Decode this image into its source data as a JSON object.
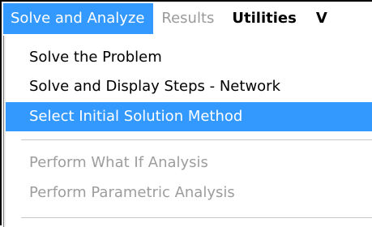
{
  "menubar": {
    "items": [
      {
        "label": "Solve and Analyze",
        "state": "active"
      },
      {
        "label": "Results",
        "state": "disabled"
      },
      {
        "label": "Utilities",
        "state": "bold"
      },
      {
        "label": "V",
        "state": "bold"
      }
    ]
  },
  "dropdown": {
    "items": [
      {
        "label": "Solve the Problem",
        "state": "enabled"
      },
      {
        "label": "Solve and Display Steps - Network",
        "state": "enabled"
      },
      {
        "label": "Select Initial Solution Method",
        "state": "highlighted"
      },
      {
        "label": "Perform What If Analysis",
        "state": "disabled"
      },
      {
        "label": "Perform Parametric Analysis",
        "state": "disabled"
      }
    ]
  },
  "colors": {
    "highlight": "#3399ff",
    "disabled_text": "#9d9d9d",
    "separator": "#c9c9c9"
  }
}
